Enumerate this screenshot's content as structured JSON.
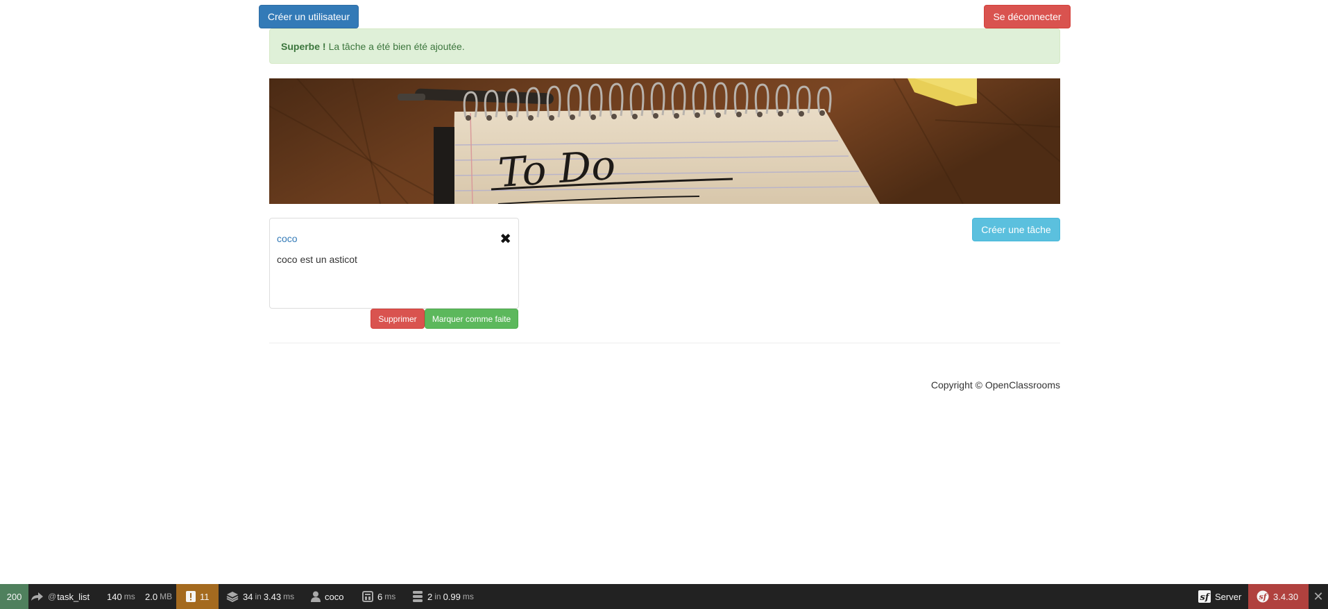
{
  "header": {
    "create_user_label": "Créer un utilisateur",
    "logout_label": "Se déconnecter"
  },
  "alert": {
    "strong": "Superbe !",
    "message": "La tâche a été bien été ajoutée."
  },
  "banner": {
    "handwriting": "To Do"
  },
  "actions": {
    "create_task_label": "Créer une tâche"
  },
  "tasks": [
    {
      "title": "coco",
      "description": "coco est un asticot",
      "status_icon": "times-icon",
      "delete_label": "Supprimer",
      "toggle_label": "Marquer comme faite"
    }
  ],
  "footer": {
    "copyright": "Copyright © OpenClassrooms"
  },
  "toolbar": {
    "status_code": "200",
    "route_prefix": "@",
    "route": "task_list",
    "time_value": "140",
    "time_unit": "ms",
    "memory_value": "2.0",
    "memory_unit": "MB",
    "logs_count": "11",
    "db_queries": "34",
    "db_in": "in",
    "db_time": "3.43",
    "db_unit": "ms",
    "user": "coco",
    "twig_time": "6",
    "twig_unit": "ms",
    "cache_calls": "2",
    "cache_in": "in",
    "cache_time": "0.99",
    "cache_unit": "ms",
    "server_label": "Server",
    "symfony_version": "3.4.30",
    "colors": {
      "status_ok": "#4f805d",
      "logs_warning": "#a46a1f",
      "version_bg": "#b0413e",
      "bar_bg": "#222222"
    }
  }
}
